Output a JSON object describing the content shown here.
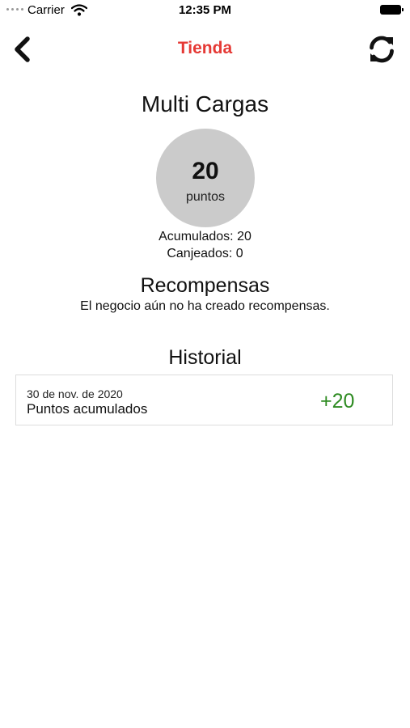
{
  "status_bar": {
    "carrier": "Carrier",
    "time": "12:35 PM",
    "icons": [
      "signal-dots-icon",
      "wifi-icon",
      "battery-icon"
    ]
  },
  "nav": {
    "title": "Tienda",
    "back_icon": "chevron-left-icon",
    "refresh_icon": "refresh-icon",
    "title_color": "#e53935"
  },
  "store": {
    "name": "Multi Cargas",
    "points": "20",
    "points_unit": "puntos",
    "accumulated": "Acumulados: 20",
    "redeemed": "Canjeados: 0",
    "circle_color": "#cbcbcb"
  },
  "rewards": {
    "title": "Recompensas",
    "empty_message": "El negocio aún no ha creado recompensas."
  },
  "history": {
    "title": "Historial",
    "entries": [
      {
        "date": "30 de nov. de 2020",
        "description": "Puntos acumulados",
        "amount": "+20",
        "amount_color": "#2e8b22"
      }
    ]
  }
}
